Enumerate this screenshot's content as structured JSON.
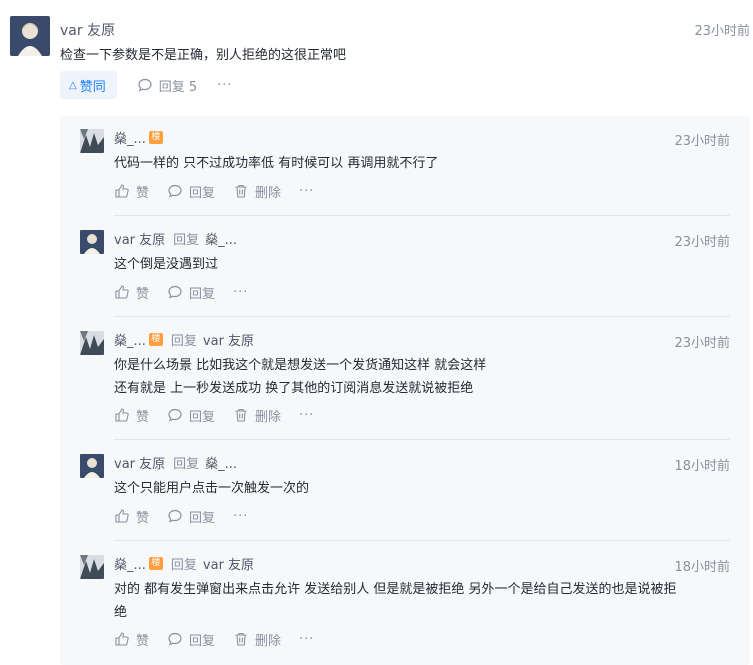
{
  "comment": {
    "author": "var 友原",
    "time": "23小时前",
    "text": "检查一下参数是不是正确，别人拒绝的这很正常吧",
    "like_label": "赞同",
    "reply_label": "回复 5",
    "more": "···"
  },
  "replies": [
    {
      "author": "燊_...",
      "badge": "楼",
      "reply_word": "",
      "reply_to": "",
      "time": "23小时前",
      "lines": [
        "代码一样的 只不过成功率低 有时候可以 再调用就不行了"
      ],
      "like": "赞",
      "reply": "回复",
      "delete": "删除",
      "more": "···"
    },
    {
      "author": "var 友原",
      "badge": "",
      "reply_word": "回复",
      "reply_to": "燊_...",
      "time": "23小时前",
      "lines": [
        "这个倒是没遇到过"
      ],
      "like": "赞",
      "reply": "回复",
      "delete": "",
      "more": "···"
    },
    {
      "author": "燊_...",
      "badge": "楼",
      "reply_word": "回复",
      "reply_to": "var 友原",
      "time": "23小时前",
      "lines": [
        "你是什么场景 比如我这个就是想发送一个发货通知这样 就会这样",
        "还有就是 上一秒发送成功 换了其他的订阅消息发送就说被拒绝"
      ],
      "like": "赞",
      "reply": "回复",
      "delete": "删除",
      "more": "···"
    },
    {
      "author": "var 友原",
      "badge": "",
      "reply_word": "回复",
      "reply_to": "燊_...",
      "time": "18小时前",
      "lines": [
        "这个只能用户点击一次触发一次的"
      ],
      "like": "赞",
      "reply": "回复",
      "delete": "",
      "more": "···"
    },
    {
      "author": "燊_...",
      "badge": "楼",
      "reply_word": "回复",
      "reply_to": "var 友原",
      "time": "18小时前",
      "lines": [
        "对的 都有发生弹窗出来点击允许 发送给别人 但是就是被拒绝 另外一个是给自己发送的也是说被拒",
        "绝"
      ],
      "like": "赞",
      "reply": "回复",
      "delete": "删除",
      "more": "···"
    }
  ],
  "colors": {
    "accent": "#1e80ff",
    "muted": "#8a919f",
    "text": "#252933",
    "reply_bg": "#f7f8fa",
    "badge": "#ff9e3c"
  }
}
